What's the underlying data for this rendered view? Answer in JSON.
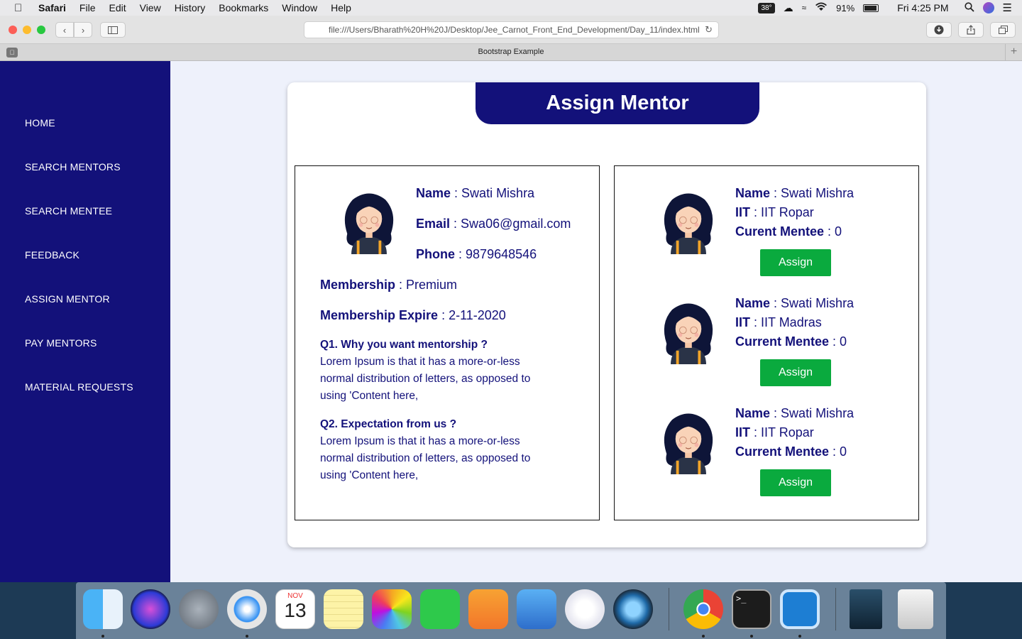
{
  "menubar": {
    "app_name": "Safari",
    "menus": [
      "File",
      "Edit",
      "View",
      "History",
      "Bookmarks",
      "Window",
      "Help"
    ],
    "temperature": "38°",
    "battery": "91%",
    "clock": "Fri 4:25 PM"
  },
  "browser": {
    "url": "file:///Users/Bharath%20H%20J/Desktop/Jee_Carnot_Front_End_Development/Day_11/index.html",
    "tab_title": "Bootstrap Example"
  },
  "sidebar": {
    "items": [
      {
        "label": "HOME"
      },
      {
        "label": "SEARCH MENTORS"
      },
      {
        "label": "SEARCH MENTEE"
      },
      {
        "label": "FEEDBACK"
      },
      {
        "label": "ASSIGN MENTOR"
      },
      {
        "label": "PAY MENTORS"
      },
      {
        "label": "MATERIAL REQUESTS"
      }
    ]
  },
  "page": {
    "title": "Assign Mentor",
    "mentee": {
      "name_label": "Name",
      "name": "Swati Mishra",
      "email_label": "Email",
      "email": "Swa06@gmail.com",
      "phone_label": "Phone",
      "phone": "9879648546",
      "membership_label": "Membership",
      "membership": "Premium",
      "expire_label": "Membership Expire",
      "expire": "2-11-2020",
      "q1": "Q1. Why you want mentorship ?",
      "a1": "Lorem Ipsum is that it has a more-or-less normal distribution of letters, as opposed to using 'Content here,",
      "q2": "Q2. Expectation from us ?",
      "a2": "Lorem Ipsum is that it has a more-or-less normal distribution of letters, as opposed to using 'Content here,"
    },
    "mentors": [
      {
        "name_label": "Name",
        "name": "Swati Mishra",
        "iit_label": "IIT",
        "iit": "IIT Ropar",
        "mentee_label": "Curent Mentee",
        "mentee": "0",
        "button": "Assign"
      },
      {
        "name_label": "Name",
        "name": "Swati Mishra",
        "iit_label": "IIT",
        "iit": "IIT Madras",
        "mentee_label": "Current Mentee",
        "mentee": "0",
        "button": "Assign"
      },
      {
        "name_label": "Name",
        "name": "Swati Mishra",
        "iit_label": "IIT",
        "iit": "IIT Ropar",
        "mentee_label": "Current Mentee",
        "mentee": "0",
        "button": "Assign"
      }
    ]
  },
  "dock": {
    "calendar_month": "NOV",
    "calendar_day": "13",
    "apps": [
      "finder-icon",
      "siri-icon",
      "launchpad-icon",
      "safari-icon",
      "calendar-icon",
      "notes-icon",
      "photos-icon",
      "facetime-icon",
      "pages-icon",
      "keynote-icon",
      "itunes-icon",
      "quicktime-icon",
      "chrome-icon",
      "terminal-icon",
      "brackets-icon",
      "movie-icon",
      "trash-icon"
    ]
  },
  "colors": {
    "navy": "#13117a",
    "assign_green": "#0aaa3e",
    "page_bg": "#eef1fb"
  }
}
